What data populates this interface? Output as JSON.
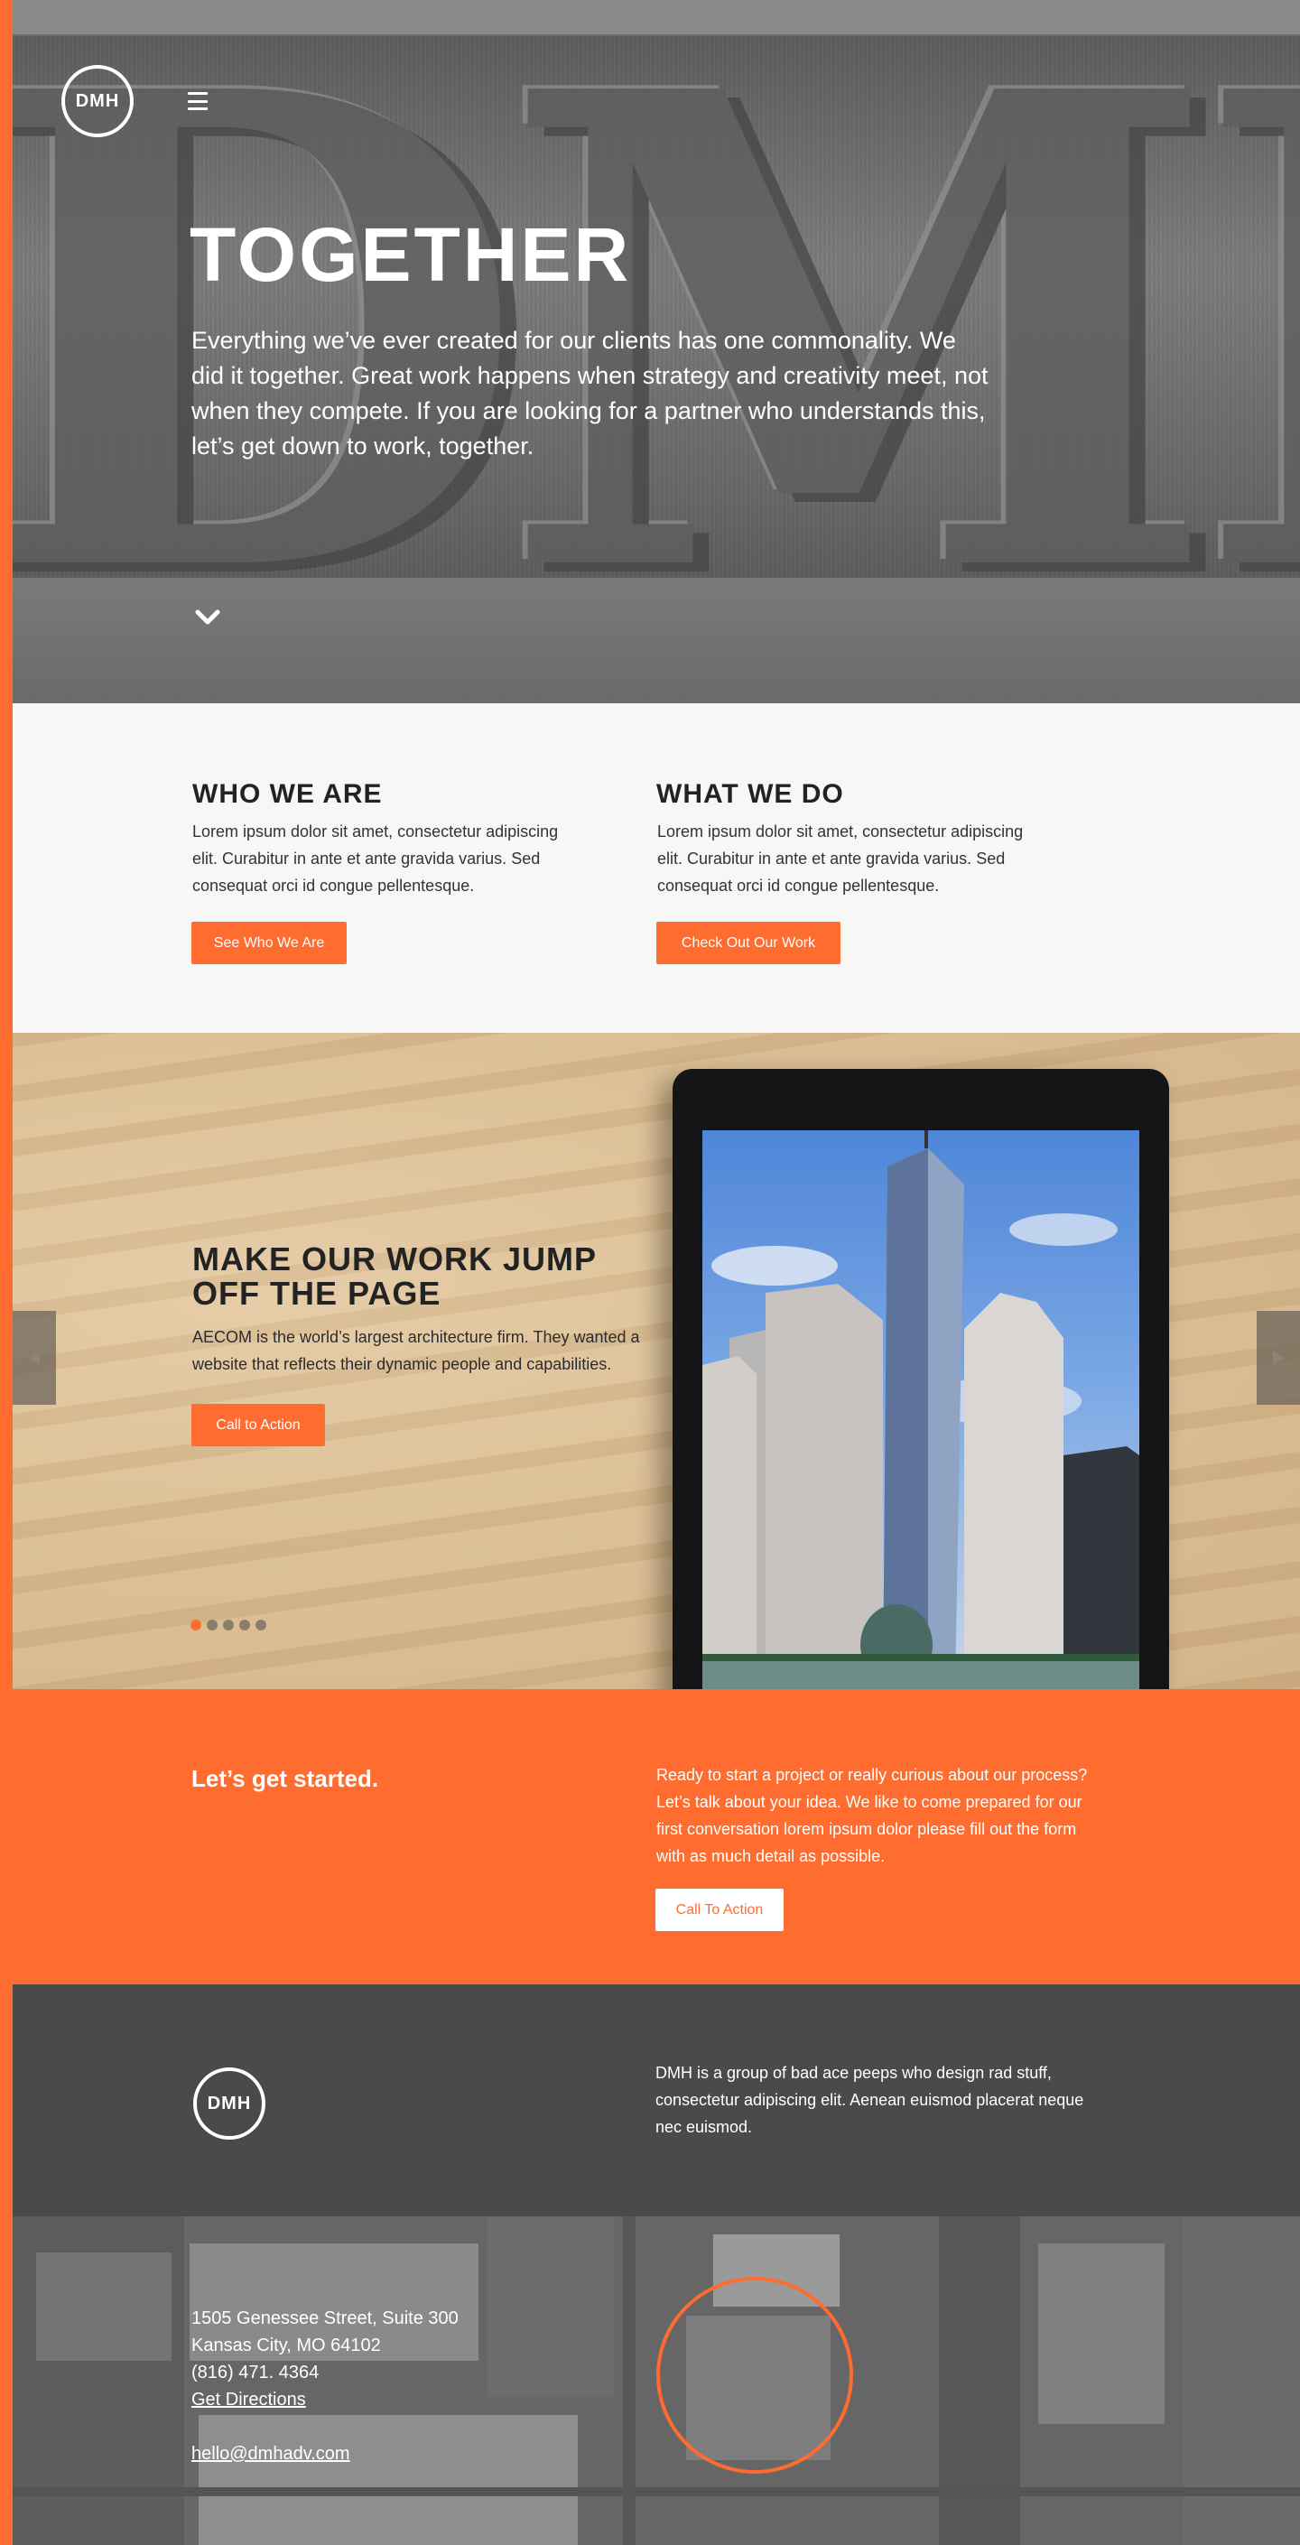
{
  "brand": {
    "logo_text": "DMH",
    "accent_color": "#ff6c2f",
    "dark_color": "#4a4a4a"
  },
  "hero": {
    "title": "TOGETHER",
    "body": "Everything we’ve ever created for our clients has one commonality. We did it together. Great work happens when strategy and creativity meet, not when they compete. If you are looking for a partner who understands this, let’s get down to work, together.",
    "menu_icon": "hamburger-icon",
    "scroll_icon": "chevron-down-icon"
  },
  "intro": {
    "left": {
      "heading": "WHO WE ARE",
      "text": "Lorem ipsum dolor sit amet, consectetur adipiscing elit. Curabitur in ante et ante gravida varius. Sed consequat orci id congue pellentesque.",
      "button": "See Who We Are"
    },
    "right": {
      "heading": "WHAT WE DO",
      "text": "Lorem ipsum dolor sit amet, consectetur adipiscing elit. Curabitur in ante et ante gravida varius. Sed consequat orci id congue pellentesque.",
      "button": "Check Out Our Work"
    }
  },
  "showcase": {
    "title": "MAKE OUR WORK JUMP OFF THE PAGE",
    "text": "AECOM is the world’s largest architecture firm. They wanted a website that reflects their dynamic people and capabilities.",
    "button": "Call to Action",
    "slides": {
      "count": 5,
      "active_index": 0
    },
    "prev_icon": "arrow-left-icon",
    "next_icon": "arrow-right-icon"
  },
  "cta": {
    "heading": "Let’s get started.",
    "text": "Ready to start a project or really curious about our process? Let’s talk about your idea. We like to come prepared for our first conversation lorem ipsum dolor please fill out the form with as much detail as possible.",
    "button": "Call To Action"
  },
  "footer": {
    "text": "DMH is a group of bad ace peeps who design rad stuff, consectetur adipiscing elit. Aenean euismod placerat neque nec euismod."
  },
  "contact": {
    "street": "1505 Genessee Street, Suite 300",
    "city": "Kansas City, MO 64102",
    "phone": "(816) 471. 4364",
    "directions": "Get Directions",
    "email": "hello@dmhadv.com"
  }
}
